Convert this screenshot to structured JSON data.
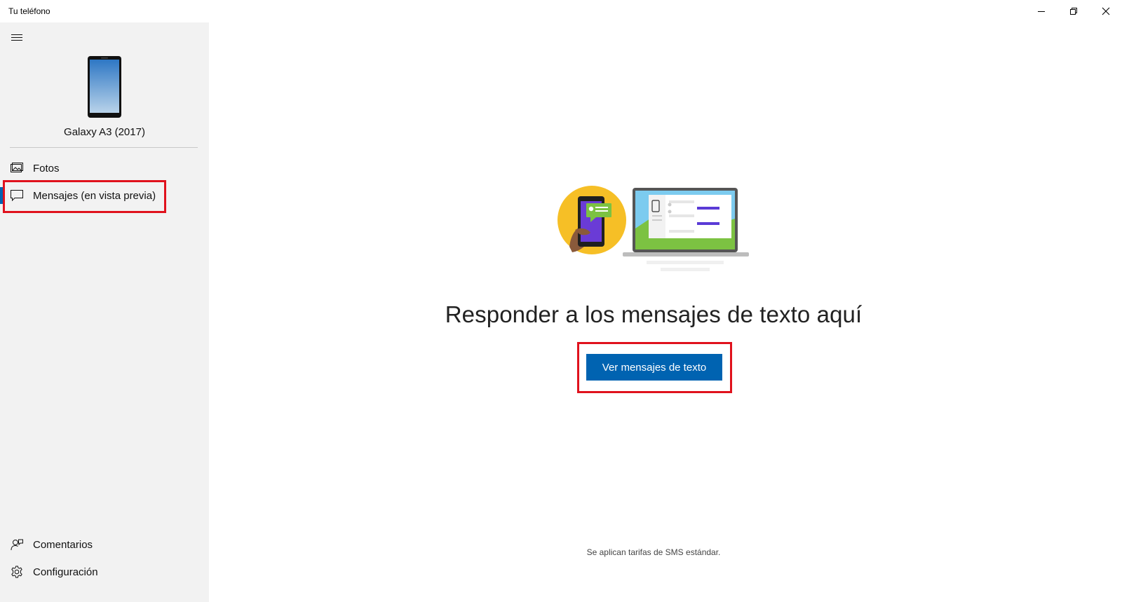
{
  "window": {
    "title": "Tu teléfono",
    "controls": [
      "minimize-icon",
      "restore-icon",
      "close-icon"
    ]
  },
  "sidebar": {
    "menu_icon": "hamburger-icon",
    "device_name": "Galaxy A3 (2017)",
    "items": [
      {
        "label": "Fotos",
        "icon": "photos-icon",
        "active": false
      },
      {
        "label": "Mensajes (en vista previa)",
        "icon": "message-icon",
        "active": true
      }
    ],
    "footer_items": [
      {
        "label": "Comentarios",
        "icon": "feedback-icon"
      },
      {
        "label": "Configuración",
        "icon": "gear-icon"
      }
    ]
  },
  "main": {
    "headline": "Responder a los mensajes de texto aquí",
    "primary_button": "Ver mensajes de texto",
    "footnote": "Se aplican tarifas de SMS estándar."
  },
  "colors": {
    "accent": "#0063b1",
    "highlight": "#e0121d",
    "sidebar_bg": "#f2f2f2"
  }
}
